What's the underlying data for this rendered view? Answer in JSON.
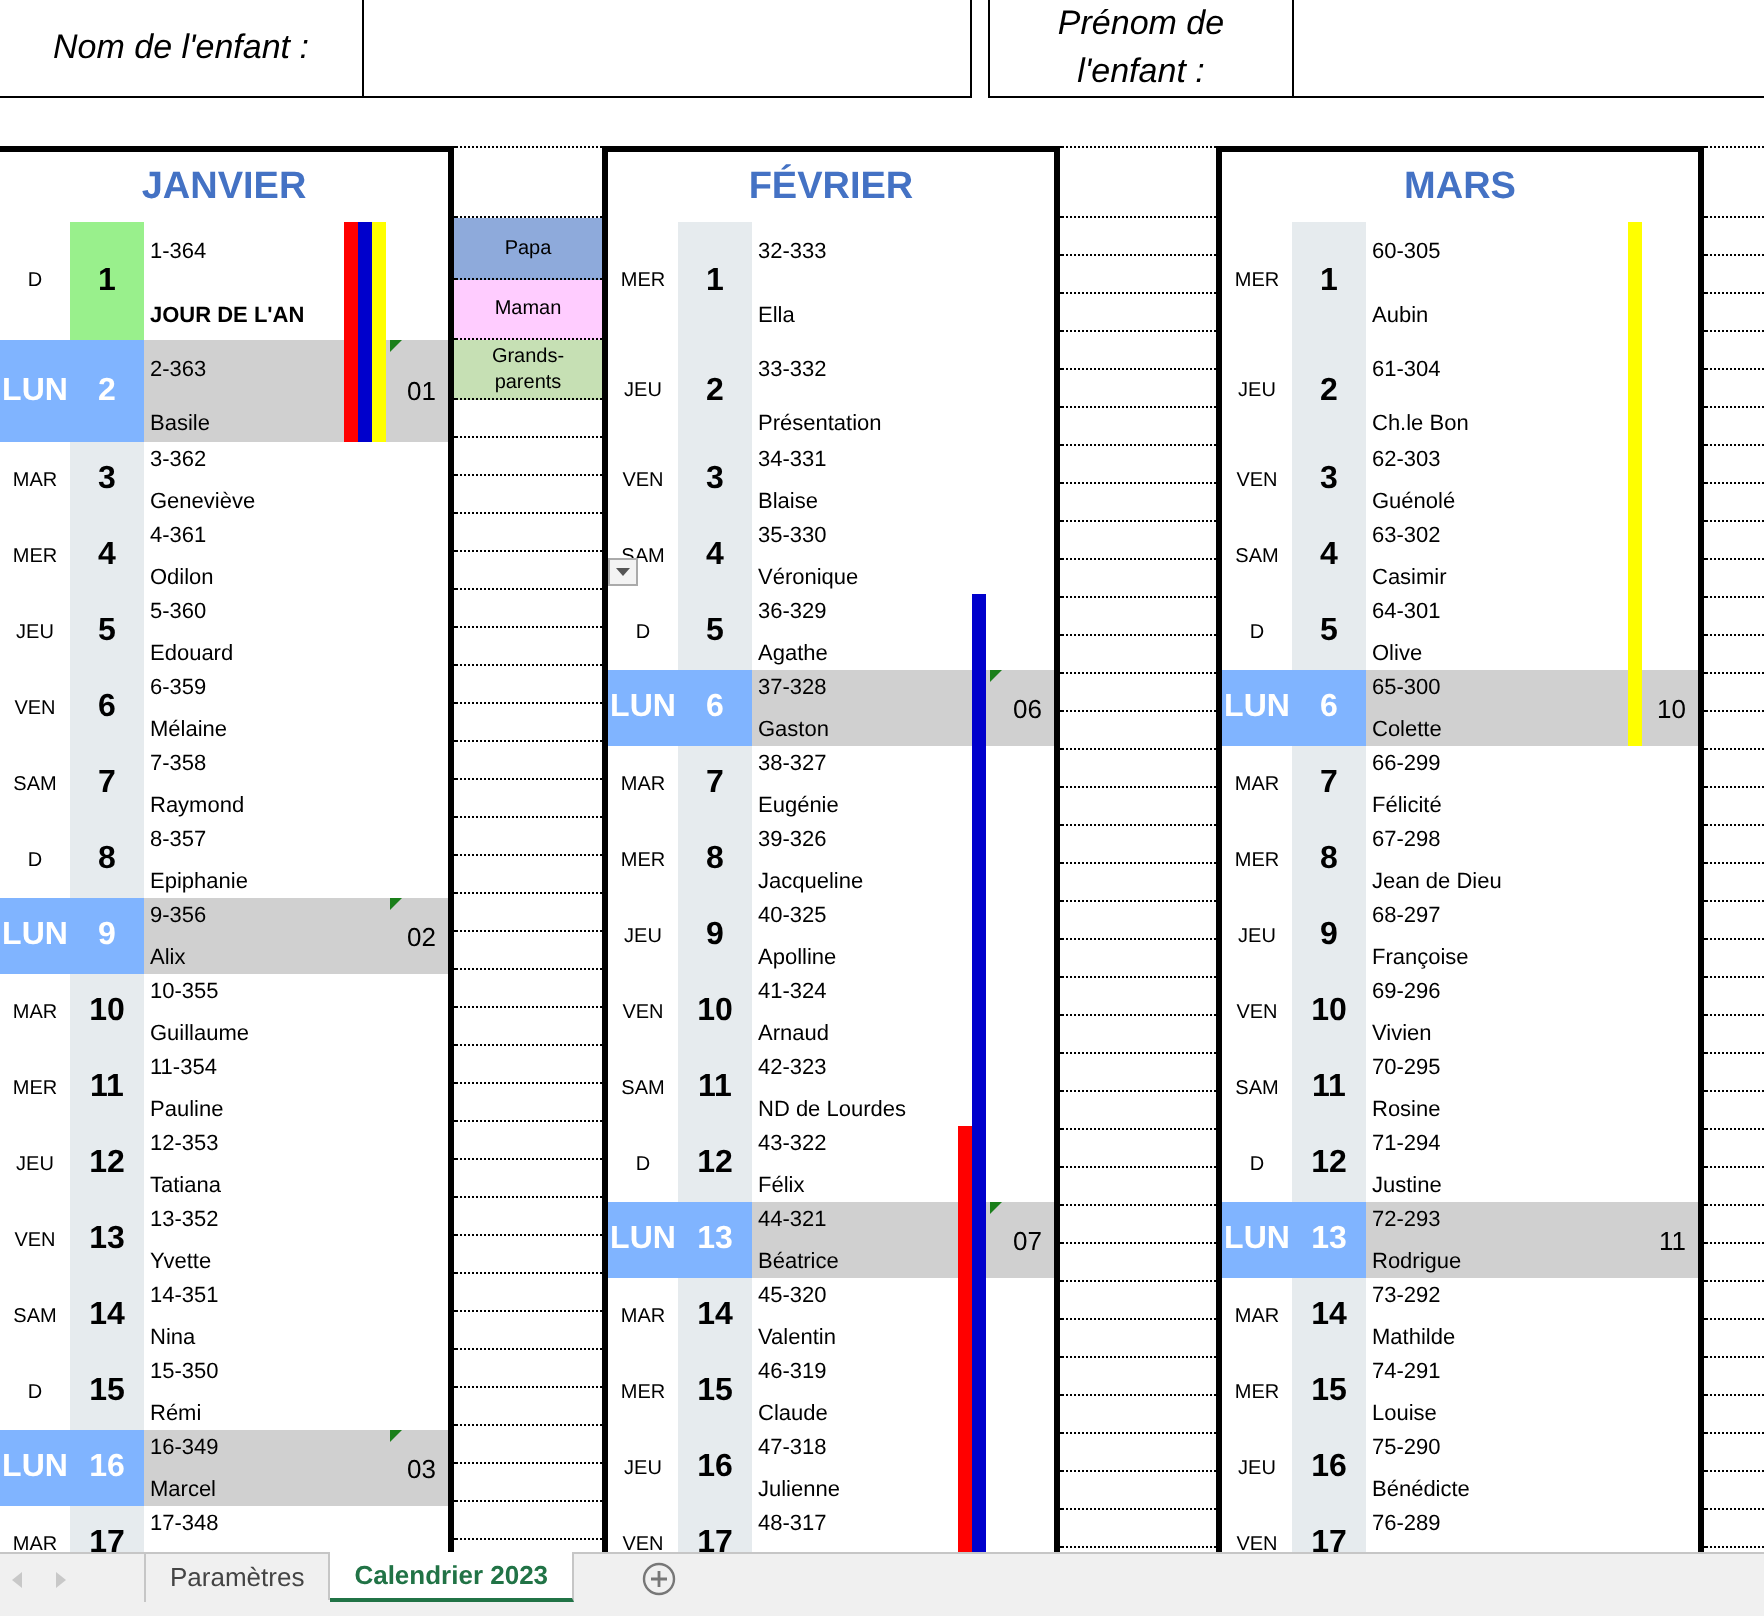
{
  "header": {
    "fields": [
      {
        "label": "Nom de l'enfant :"
      },
      {
        "label": "Prénom de l'enfant :"
      }
    ]
  },
  "legend": [
    {
      "label": "Papa",
      "color": "#8eaadb"
    },
    {
      "label": "Maman",
      "color": "#ffccff"
    },
    {
      "label": "Grands-parents",
      "color": "#c6e0b4"
    }
  ],
  "months": [
    {
      "title": "JANVIER",
      "days": [
        {
          "weekday": "D",
          "number": "1",
          "code": "1-364",
          "name": "JOUR DE L'AN",
          "holiday": true,
          "week_start": false,
          "comment": false,
          "bars": [
            {
              "color": "#ff0000"
            },
            {
              "color": "#0000cc"
            },
            {
              "color": "#ffff00"
            }
          ]
        },
        {
          "weekday": "LUN",
          "number": "2",
          "code": "2-363",
          "name": "Basile",
          "holiday": false,
          "week_start": true,
          "week": "01",
          "comment": true,
          "bars": [
            {
              "color": "#ff0000"
            },
            {
              "color": "#0000cc"
            },
            {
              "color": "#ffff00"
            }
          ]
        },
        {
          "weekday": "MAR",
          "number": "3",
          "code": "3-362",
          "name": "Geneviève",
          "holiday": false,
          "week_start": false,
          "comment": false
        },
        {
          "weekday": "MER",
          "number": "4",
          "code": "4-361",
          "name": "Odilon",
          "holiday": false,
          "week_start": false,
          "comment": false
        },
        {
          "weekday": "JEU",
          "number": "5",
          "code": "5-360",
          "name": "Edouard",
          "holiday": false,
          "week_start": false,
          "comment": false
        },
        {
          "weekday": "VEN",
          "number": "6",
          "code": "6-359",
          "name": "Mélaine",
          "holiday": false,
          "week_start": false,
          "comment": false
        },
        {
          "weekday": "SAM",
          "number": "7",
          "code": "7-358",
          "name": "Raymond",
          "holiday": false,
          "week_start": false,
          "comment": false
        },
        {
          "weekday": "D",
          "number": "8",
          "code": "8-357",
          "name": "Epiphanie",
          "holiday": false,
          "week_start": false,
          "comment": false
        },
        {
          "weekday": "LUN",
          "number": "9",
          "code": "9-356",
          "name": "Alix",
          "holiday": false,
          "week_start": true,
          "week": "02",
          "comment": true
        },
        {
          "weekday": "MAR",
          "number": "10",
          "code": "10-355",
          "name": "Guillaume",
          "holiday": false,
          "week_start": false,
          "comment": false
        },
        {
          "weekday": "MER",
          "number": "11",
          "code": "11-354",
          "name": "Pauline",
          "holiday": false,
          "week_start": false,
          "comment": false
        },
        {
          "weekday": "JEU",
          "number": "12",
          "code": "12-353",
          "name": "Tatiana",
          "holiday": false,
          "week_start": false,
          "comment": false
        },
        {
          "weekday": "VEN",
          "number": "13",
          "code": "13-352",
          "name": "Yvette",
          "holiday": false,
          "week_start": false,
          "comment": false
        },
        {
          "weekday": "SAM",
          "number": "14",
          "code": "14-351",
          "name": "Nina",
          "holiday": false,
          "week_start": false,
          "comment": false
        },
        {
          "weekday": "D",
          "number": "15",
          "code": "15-350",
          "name": "Rémi",
          "holiday": false,
          "week_start": false,
          "comment": false
        },
        {
          "weekday": "LUN",
          "number": "16",
          "code": "16-349",
          "name": "Marcel",
          "holiday": false,
          "week_start": true,
          "week": "03",
          "comment": true
        },
        {
          "weekday": "MAR",
          "number": "17",
          "code": "17-348",
          "holiday": false,
          "week_start": false,
          "comment": false
        }
      ]
    },
    {
      "title": "FÉVRIER",
      "days": [
        {
          "weekday": "MER",
          "number": "1",
          "code": "32-333",
          "name": "Ella",
          "holiday": false,
          "week_start": false,
          "comment": false
        },
        {
          "weekday": "JEU",
          "number": "2",
          "code": "33-332",
          "name": "Présentation",
          "holiday": false,
          "week_start": false,
          "comment": false
        },
        {
          "weekday": "VEN",
          "number": "3",
          "code": "34-331",
          "name": "Blaise",
          "holiday": false,
          "week_start": false,
          "comment": false
        },
        {
          "weekday": "SAM",
          "number": "4",
          "code": "35-330",
          "name": "Véronique",
          "holiday": false,
          "week_start": false,
          "comment": false
        },
        {
          "weekday": "D",
          "number": "5",
          "code": "36-329",
          "name": "Agathe",
          "holiday": false,
          "week_start": false,
          "comment": false,
          "bars": [
            {
              "color": "#0000cc"
            }
          ]
        },
        {
          "weekday": "LUN",
          "number": "6",
          "code": "37-328",
          "name": "Gaston",
          "holiday": false,
          "week_start": true,
          "week": "06",
          "comment": true,
          "bars": [
            {
              "color": "#0000cc"
            }
          ]
        },
        {
          "weekday": "MAR",
          "number": "7",
          "code": "38-327",
          "name": "Eugénie",
          "holiday": false,
          "week_start": false,
          "comment": false,
          "bars": [
            {
              "color": "#0000cc"
            }
          ]
        },
        {
          "weekday": "MER",
          "number": "8",
          "code": "39-326",
          "name": "Jacqueline",
          "holiday": false,
          "week_start": false,
          "comment": false,
          "bars": [
            {
              "color": "#0000cc"
            }
          ]
        },
        {
          "weekday": "JEU",
          "number": "9",
          "code": "40-325",
          "name": "Apolline",
          "holiday": false,
          "week_start": false,
          "comment": false,
          "bars": [
            {
              "color": "#0000cc"
            }
          ]
        },
        {
          "weekday": "VEN",
          "number": "10",
          "code": "41-324",
          "name": "Arnaud",
          "holiday": false,
          "week_start": false,
          "comment": false,
          "bars": [
            {
              "color": "#0000cc"
            }
          ]
        },
        {
          "weekday": "SAM",
          "number": "11",
          "code": "42-323",
          "name": "ND de Lourdes",
          "holiday": false,
          "week_start": false,
          "comment": false,
          "bars": [
            {
              "color": "#0000cc"
            }
          ]
        },
        {
          "weekday": "D",
          "number": "12",
          "code": "43-322",
          "name": "Félix",
          "holiday": false,
          "week_start": false,
          "comment": false,
          "bars": [
            {
              "color": "#ff0000"
            },
            {
              "color": "#0000cc"
            }
          ]
        },
        {
          "weekday": "LUN",
          "number": "13",
          "code": "44-321",
          "name": "Béatrice",
          "holiday": false,
          "week_start": true,
          "week": "07",
          "comment": true,
          "bars": [
            {
              "color": "#ff0000"
            },
            {
              "color": "#0000cc"
            }
          ]
        },
        {
          "weekday": "MAR",
          "number": "14",
          "code": "45-320",
          "name": "Valentin",
          "holiday": false,
          "week_start": false,
          "comment": false,
          "bars": [
            {
              "color": "#ff0000"
            },
            {
              "color": "#0000cc"
            }
          ]
        },
        {
          "weekday": "MER",
          "number": "15",
          "code": "46-319",
          "name": "Claude",
          "holiday": false,
          "week_start": false,
          "comment": false,
          "bars": [
            {
              "color": "#ff0000"
            },
            {
              "color": "#0000cc"
            }
          ]
        },
        {
          "weekday": "JEU",
          "number": "16",
          "code": "47-318",
          "name": "Julienne",
          "holiday": false,
          "week_start": false,
          "comment": false,
          "bars": [
            {
              "color": "#ff0000"
            },
            {
              "color": "#0000cc"
            }
          ]
        },
        {
          "weekday": "VEN",
          "number": "17",
          "code": "48-317",
          "holiday": false,
          "week_start": false,
          "comment": false,
          "bars": [
            {
              "color": "#ff0000"
            },
            {
              "color": "#0000cc"
            }
          ]
        }
      ]
    },
    {
      "title": "MARS",
      "days": [
        {
          "weekday": "MER",
          "number": "1",
          "code": "60-305",
          "name": "Aubin",
          "holiday": false,
          "week_start": false,
          "comment": false,
          "bars": [
            {
              "color": "#ffff00"
            }
          ]
        },
        {
          "weekday": "JEU",
          "number": "2",
          "code": "61-304",
          "name": "Ch.le Bon",
          "holiday": false,
          "week_start": false,
          "comment": false,
          "bars": [
            {
              "color": "#ffff00"
            }
          ]
        },
        {
          "weekday": "VEN",
          "number": "3",
          "code": "62-303",
          "name": "Guénolé",
          "holiday": false,
          "week_start": false,
          "comment": false,
          "bars": [
            {
              "color": "#ffff00"
            }
          ]
        },
        {
          "weekday": "SAM",
          "number": "4",
          "code": "63-302",
          "name": "Casimir",
          "holiday": false,
          "week_start": false,
          "comment": false,
          "bars": [
            {
              "color": "#ffff00"
            }
          ]
        },
        {
          "weekday": "D",
          "number": "5",
          "code": "64-301",
          "name": "Olive",
          "holiday": false,
          "week_start": false,
          "comment": false,
          "bars": [
            {
              "color": "#ffff00"
            }
          ]
        },
        {
          "weekday": "LUN",
          "number": "6",
          "code": "65-300",
          "name": "Colette",
          "holiday": false,
          "week_start": true,
          "week": "10",
          "comment": false,
          "bars": [
            {
              "color": "#ffff00"
            }
          ]
        },
        {
          "weekday": "MAR",
          "number": "7",
          "code": "66-299",
          "name": "Félicité",
          "holiday": false,
          "week_start": false,
          "comment": false
        },
        {
          "weekday": "MER",
          "number": "8",
          "code": "67-298",
          "name": "Jean de Dieu",
          "holiday": false,
          "week_start": false,
          "comment": false
        },
        {
          "weekday": "JEU",
          "number": "9",
          "code": "68-297",
          "name": "Françoise",
          "holiday": false,
          "week_start": false,
          "comment": false
        },
        {
          "weekday": "VEN",
          "number": "10",
          "code": "69-296",
          "name": "Vivien",
          "holiday": false,
          "week_start": false,
          "comment": false
        },
        {
          "weekday": "SAM",
          "number": "11",
          "code": "70-295",
          "name": "Rosine",
          "holiday": false,
          "week_start": false,
          "comment": false
        },
        {
          "weekday": "D",
          "number": "12",
          "code": "71-294",
          "name": "Justine",
          "holiday": false,
          "week_start": false,
          "comment": false
        },
        {
          "weekday": "LUN",
          "number": "13",
          "code": "72-293",
          "name": "Rodrigue",
          "holiday": false,
          "week_start": true,
          "week": "11",
          "comment": false
        },
        {
          "weekday": "MAR",
          "number": "14",
          "code": "73-292",
          "name": "Mathilde",
          "holiday": false,
          "week_start": false,
          "comment": false
        },
        {
          "weekday": "MER",
          "number": "15",
          "code": "74-291",
          "name": "Louise",
          "holiday": false,
          "week_start": false,
          "comment": false
        },
        {
          "weekday": "JEU",
          "number": "16",
          "code": "75-290",
          "name": "Bénédicte",
          "holiday": false,
          "week_start": false,
          "comment": false
        },
        {
          "weekday": "VEN",
          "number": "17",
          "code": "76-289",
          "holiday": false,
          "week_start": false,
          "comment": false
        }
      ]
    }
  ],
  "sheet_tabs": [
    {
      "label": "Paramètres",
      "selected": false
    },
    {
      "label": "Calendrier 2023",
      "selected": true
    }
  ]
}
